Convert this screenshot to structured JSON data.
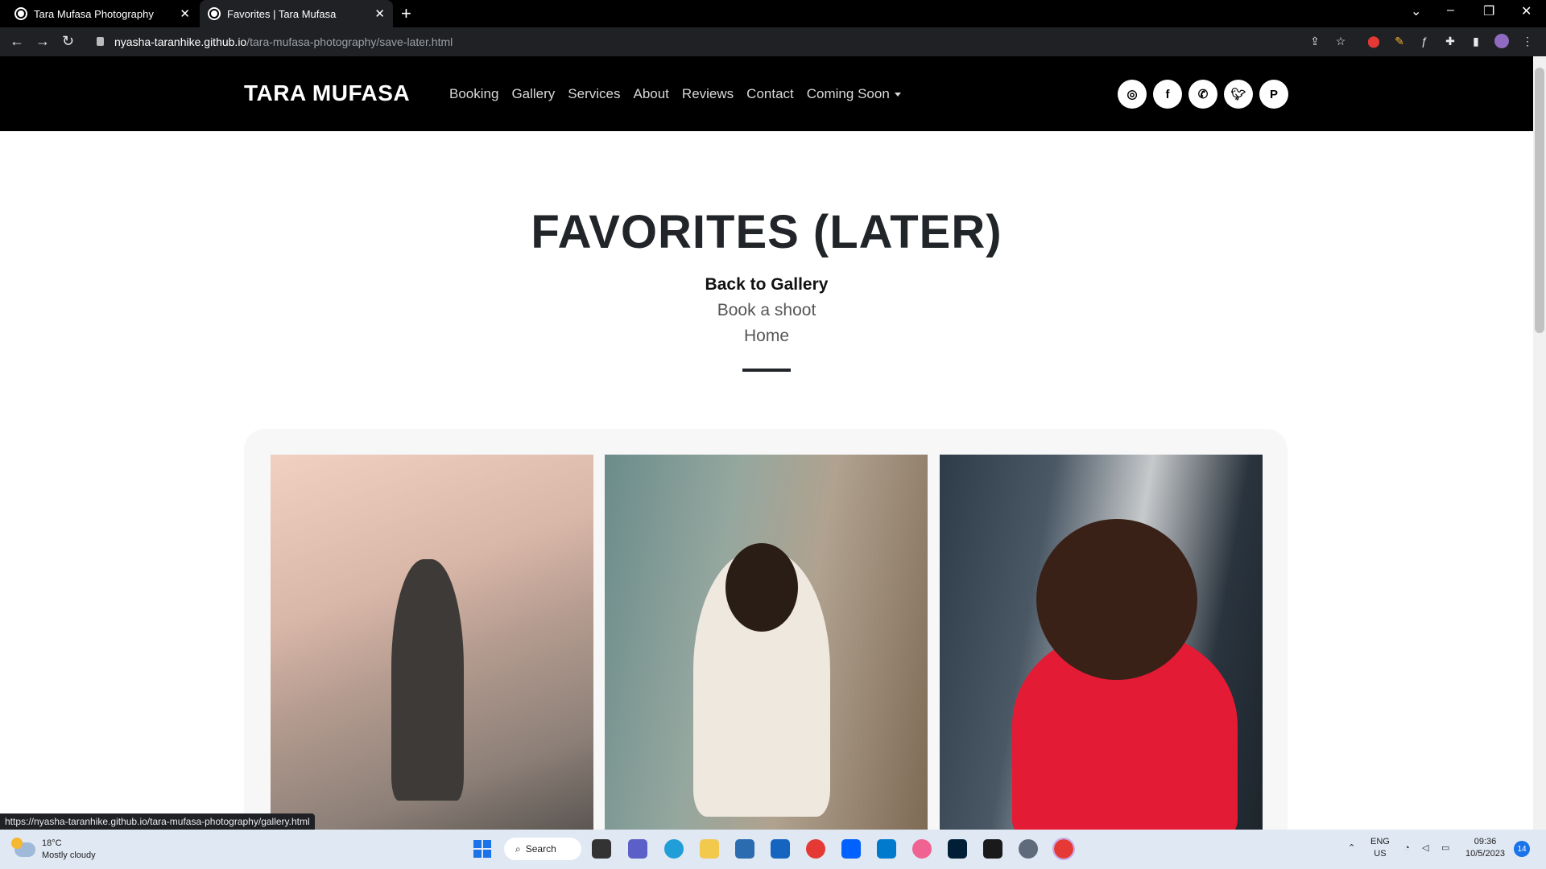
{
  "browser": {
    "tabs": [
      {
        "title": "Tara Mufasa Photography"
      },
      {
        "title": "Favorites | Tara Mufasa"
      }
    ],
    "url_host": "nyasha-taranhike.github.io",
    "url_path": "/tara-mufasa-photography/save-later.html",
    "status_url": "https://nyasha-taranhike.github.io/tara-mufasa-photography/gallery.html"
  },
  "site": {
    "brand": "TARA MUFASA",
    "menu": [
      "Booking",
      "Gallery",
      "Services",
      "About",
      "Reviews",
      "Contact",
      "Coming Soon"
    ],
    "socials": [
      "instagram-icon",
      "facebook-icon",
      "whatsapp-icon",
      "twitter-icon",
      "patreon-icon"
    ]
  },
  "content": {
    "title": "FAVORITES (LATER)",
    "links": [
      "Back to Gallery",
      "Book a shoot",
      "Home"
    ]
  },
  "taskbar": {
    "temp": "18°C",
    "weather": "Mostly cloudy",
    "search": "Search",
    "lang": "ENG",
    "region": "US",
    "time": "09:36",
    "date": "10/5/2023",
    "notifications": "14"
  },
  "colors": {
    "header_bg": "#000000",
    "title": "#212529",
    "accent_red": "#e41b34"
  }
}
